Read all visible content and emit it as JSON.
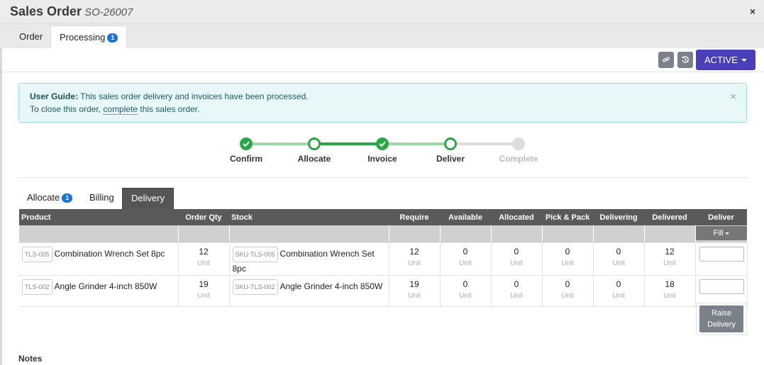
{
  "window": {
    "title": "Sales Order",
    "order_number": "SO-26007",
    "close_icon": "×"
  },
  "tabs": [
    {
      "label": "Order"
    },
    {
      "label": "Processing",
      "badge": "1"
    }
  ],
  "toolbar": {
    "link_icon": "link-icon",
    "history_icon": "history-icon",
    "status_label": "ACTIVE"
  },
  "guide": {
    "prefix": "User Guide:",
    "line1": " This sales order delivery and invoices have been processed.",
    "line2_before": "To close this order, ",
    "line2_link": "complete",
    "line2_after": " this sales order.",
    "close": "×"
  },
  "steps": [
    {
      "label": "Confirm",
      "state": "done"
    },
    {
      "label": "Allocate",
      "state": "current"
    },
    {
      "label": "Invoice",
      "state": "done"
    },
    {
      "label": "Deliver",
      "state": "current"
    },
    {
      "label": "Complete",
      "state": "future"
    }
  ],
  "subtabs": [
    {
      "label": "Allocate",
      "badge": "1"
    },
    {
      "label": "Billing"
    },
    {
      "label": "Delivery"
    }
  ],
  "table": {
    "headers": [
      "Product",
      "Order Qty",
      "Stock",
      "Require",
      "Available",
      "Allocated",
      "Pick & Pack",
      "Delivering",
      "Delivered",
      "Deliver"
    ],
    "fill_label": "Fill",
    "unit": "Unit",
    "rows": [
      {
        "code": "TLS-005",
        "name": "Combination Wrench Set 8pc",
        "order_qty": "12",
        "stock_code": "SKU-TLS-005",
        "stock_name": "Combination Wrench Set 8pc",
        "require": "12",
        "available": "0",
        "allocated": "0",
        "pick_pack": "0",
        "delivering": "0",
        "delivered": "12"
      },
      {
        "code": "TLS-002",
        "name": "Angle Grinder 4-inch 850W",
        "order_qty": "19",
        "stock_code": "SKU-TLS-002",
        "stock_name": "Angle Grinder 4-inch 850W",
        "require": "19",
        "available": "0",
        "allocated": "0",
        "pick_pack": "0",
        "delivering": "0",
        "delivered": "18"
      }
    ],
    "raise_label_1": "Raise",
    "raise_label_2": "Delivery"
  },
  "notes_label": "Notes",
  "colors": {
    "accent": "#4a3fb8",
    "step_green": "#28a745",
    "badge_blue": "#1a73d9",
    "header_dark": "#5a5a5a"
  }
}
